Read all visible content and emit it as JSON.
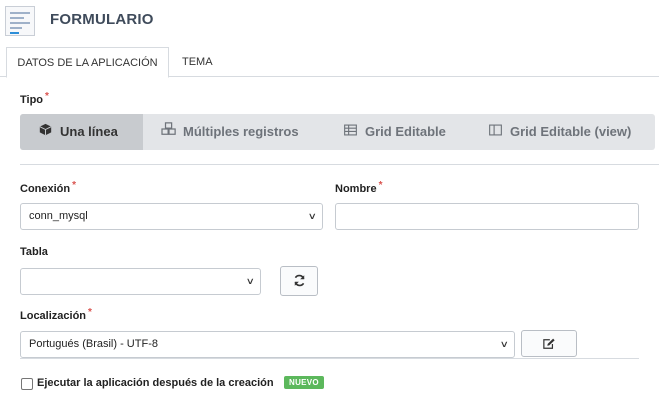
{
  "header": {
    "title": "FORMULARIO",
    "icon": "form-document-icon"
  },
  "tabs": [
    {
      "label": "DATOS DE LA APLICACIÓN",
      "active": true
    },
    {
      "label": "TEMA",
      "active": false
    }
  ],
  "tipo": {
    "label": "Tipo",
    "required_mark": "*",
    "options": [
      {
        "label": "Una línea",
        "icon": "cube-icon",
        "selected": true
      },
      {
        "label": "Múltiples registros",
        "icon": "cubes-icon",
        "selected": false
      },
      {
        "label": "Grid Editable",
        "icon": "table-grid-icon",
        "selected": false
      },
      {
        "label": "Grid Editable (view)",
        "icon": "columns-icon",
        "selected": false
      }
    ]
  },
  "conexion": {
    "label": "Conexión",
    "required_mark": "*",
    "value": "conn_mysql"
  },
  "nombre": {
    "label": "Nombre",
    "required_mark": "*",
    "value": ""
  },
  "tabla": {
    "label": "Tabla",
    "value": "",
    "refresh_icon": "refresh-icon"
  },
  "localizacion": {
    "label": "Localización",
    "required_mark": "*",
    "value": "Portugués (Brasil) - UTF-8",
    "edit_icon": "edit-icon"
  },
  "ejecutar": {
    "label": "Ejecutar la aplicación después de la creación",
    "checked": false,
    "badge": "NUEVO"
  },
  "colors": {
    "accent": "#c8cbcf",
    "bar": "#e3e5e8",
    "required": "#d9534f",
    "badge": "#5cb85c",
    "title": "#3f4b5b"
  }
}
